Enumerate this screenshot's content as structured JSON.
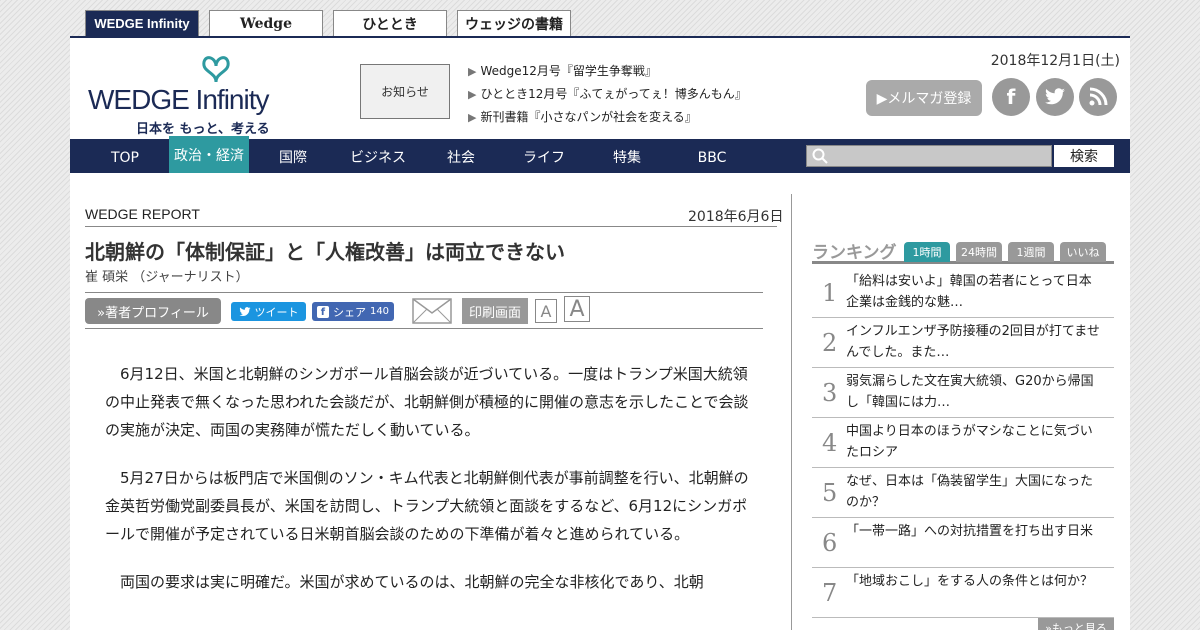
{
  "site_tabs": [
    {
      "label": "WEDGE Infinity"
    },
    {
      "label": "Wedge"
    },
    {
      "label": "ひととき"
    },
    {
      "label": "ウェッジの書籍"
    }
  ],
  "header": {
    "logo_main": "WEDGE Infinity",
    "logo_sub": "日本を もっと、考える",
    "notice_label": "お知らせ",
    "news": [
      "Wedge12月号『留学生争奪戦』",
      "ひととき12月号『ふてぇがってぇ！博多んもん』",
      "新刊書籍『小さなパンが社会を変える』"
    ],
    "date": "2018年12月1日(土)",
    "mailmag_label": "▶メルマガ登録"
  },
  "nav": {
    "items": [
      "TOP",
      "政治・経済",
      "国際",
      "ビジネス",
      "社会",
      "ライフ",
      "特集",
      "BBC"
    ],
    "search_button": "検索"
  },
  "article": {
    "section": "WEDGE REPORT",
    "date": "2018年6月6日",
    "title": "北朝鮮の「体制保証」と「人権改善」は両立できない",
    "author": "崔 碩栄 （ジャーナリスト）",
    "profile_button": "»著者プロフィール",
    "tweet_button": "ツイート",
    "share_button": "シェア",
    "share_count": "140",
    "print_button": "印刷画面",
    "font_small": "A",
    "font_large": "A",
    "paragraphs": [
      "6月12日、米国と北朝鮮のシンガポール首脳会談が近づいている。一度はトランプ米国大統領の中止発表で無くなった思われた会談だが、北朝鮮側が積極的に開催の意志を示したことで会談の実施が決定、両国の実務陣が慌ただしく動いている。",
      "5月27日からは板門店で米国側のソン・キム代表と北朝鮮側代表が事前調整を行い、北朝鮮の金英哲労働党副委員長が、米国を訪問し、トランプ大統領と面談をするなど、6月12にシンガポールで開催が予定されている日米朝首脳会談のための下準備が着々と進められている。",
      "両国の要求は実に明確だ。米国が求めているのは、北朝鮮の完全な非核化であり、北朝"
    ]
  },
  "ranking": {
    "title": "ランキング",
    "tabs": [
      "1時間",
      "24時間",
      "1週間",
      "いいね"
    ],
    "items": [
      {
        "num": "1",
        "text": "「給料は安いよ」韓国の若者にとって日本企業は金銭的な魅…"
      },
      {
        "num": "2",
        "text": "インフルエンザ予防接種の2回目が打てませんでした。また…"
      },
      {
        "num": "3",
        "text": "弱気漏らした文在寅大統領、G20から帰国し「韓国には力…"
      },
      {
        "num": "4",
        "text": "中国より日本のほうがマシなことに気づいたロシア"
      },
      {
        "num": "5",
        "text": "なぜ、日本は「偽装留学生」大国になったのか？"
      },
      {
        "num": "6",
        "text": "「一帯一路」への対抗措置を打ち出す日米"
      },
      {
        "num": "7",
        "text": "「地域おこし」をする人の条件とは何か？"
      }
    ],
    "more_label": "»もっと見る"
  }
}
